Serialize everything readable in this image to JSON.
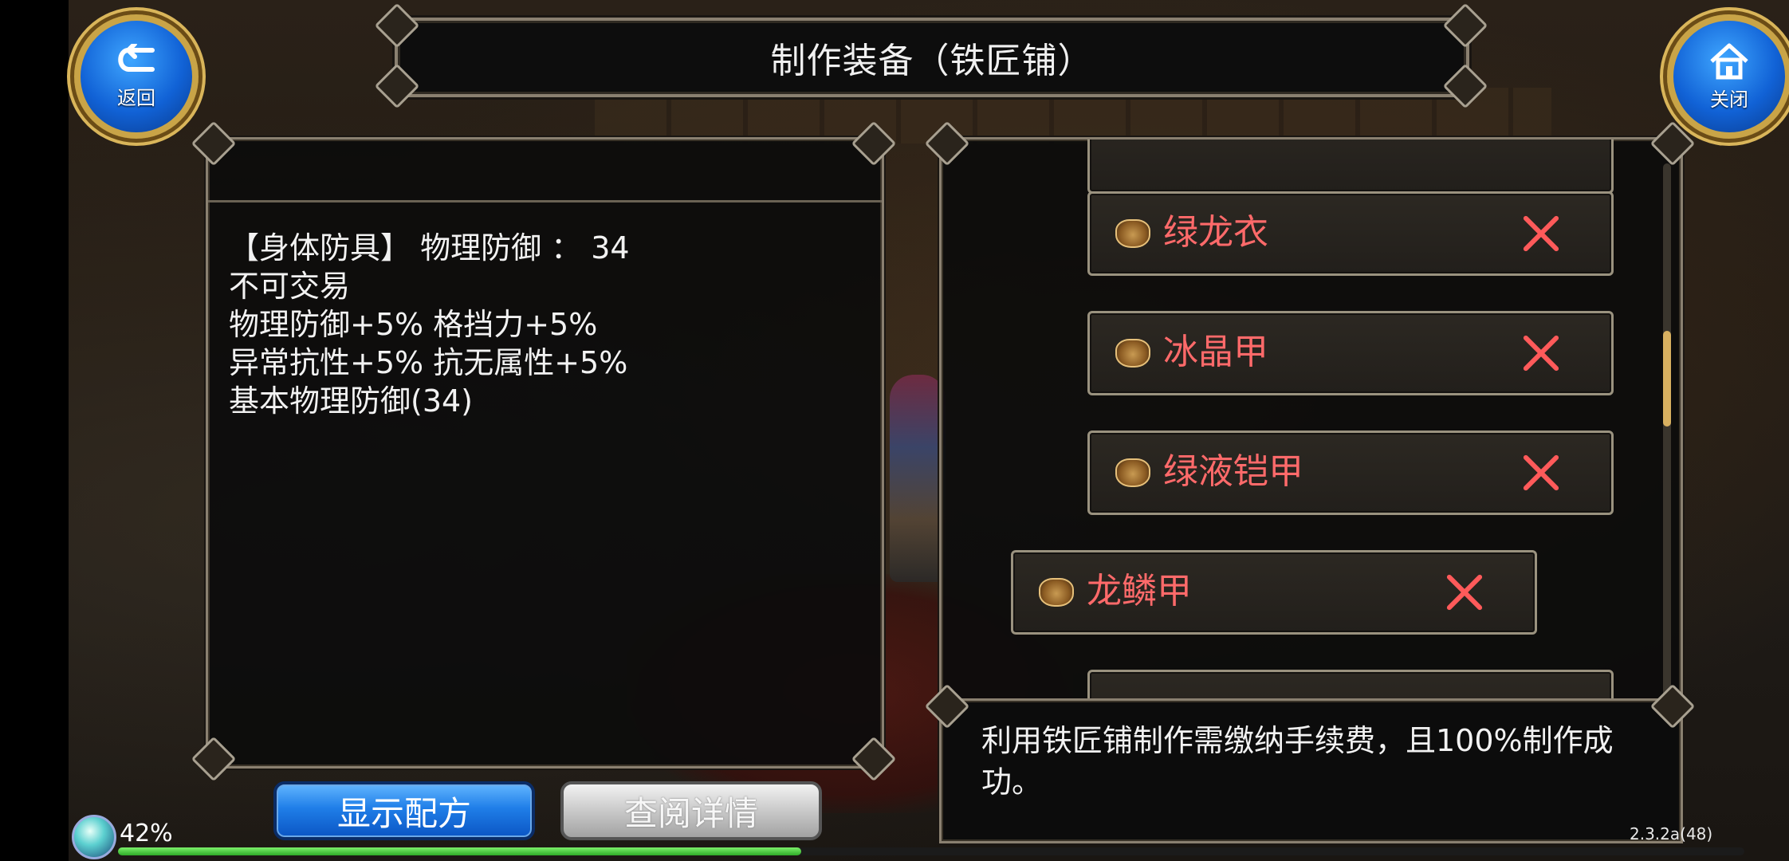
{
  "window_title": "制作装备（铁匠铺）",
  "nav": {
    "back_label": "返回",
    "close_label": "关闭"
  },
  "item_detail": {
    "lines": [
      "【身体防具】 物理防御 ： 34",
      "不可交易",
      "物理防御+5% 格挡力+5%",
      "异常抗性+5% 抗无属性+5%",
      "基本物理防御(34)"
    ]
  },
  "recipe_list": {
    "items": [
      {
        "name": "绿龙衣"
      },
      {
        "name": "冰晶甲"
      },
      {
        "name": "绿液铠甲"
      },
      {
        "name": "龙鳞甲"
      }
    ],
    "selected_index": 3
  },
  "notice": "利用铁匠铺制作需缴纳手续费，且100%制作成功。",
  "buttons": {
    "show_recipe": "显示配方",
    "view_details": "查阅详情"
  },
  "status": {
    "battery": "42%",
    "exp_progress": 0.42,
    "version": "2.3.2a(48)"
  },
  "colors": {
    "item_name": "#ff6a6a",
    "frame": "#8a8070",
    "button_blue": "#1f7ee8"
  }
}
